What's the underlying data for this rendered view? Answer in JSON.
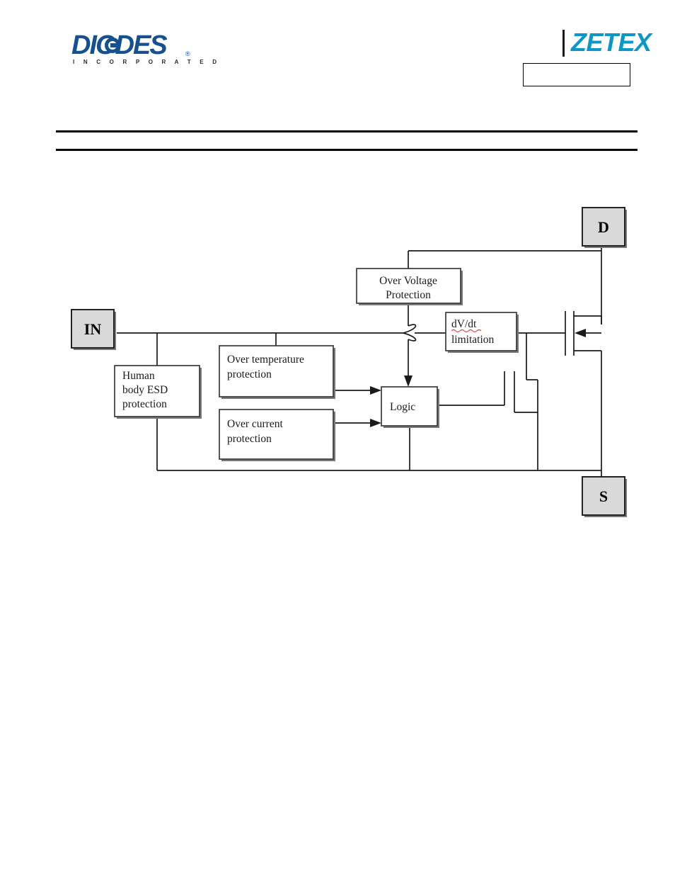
{
  "header": {
    "brand_left": {
      "name": "DIODES",
      "tagline": "I N C O R P O R A T E D",
      "registered": "®",
      "color": "#17508f"
    },
    "brand_right": {
      "name": "ZETEX",
      "color": "#0d97c6"
    },
    "part_box": {
      "value": ""
    }
  },
  "diagram": {
    "title": "",
    "terminals": [
      {
        "id": "in",
        "label": "IN"
      },
      {
        "id": "d",
        "label": "D"
      },
      {
        "id": "s",
        "label": "S"
      }
    ],
    "blocks": [
      {
        "id": "over-voltage-protection",
        "lines": [
          "Over Voltage",
          "Protection"
        ],
        "align": "center"
      },
      {
        "id": "over-temperature-protection",
        "lines": [
          "Over temperature",
          "protection"
        ],
        "align": "left"
      },
      {
        "id": "over-current-protection",
        "lines": [
          "Over current",
          "protection"
        ],
        "align": "left"
      },
      {
        "id": "human-body-esd-protection",
        "lines": [
          "Human",
          "body ESD",
          "protection"
        ],
        "align": "left"
      },
      {
        "id": "logic",
        "lines": [
          "Logic"
        ],
        "align": "left"
      },
      {
        "id": "dvdt-limitation",
        "lines": [
          "dV/dt",
          "limitation"
        ],
        "align": "left",
        "spellcheck_underline": true
      }
    ],
    "components": [
      {
        "id": "power-mosfet",
        "type": "mosfet-n-channel"
      },
      {
        "id": "wire-hop",
        "type": "wire-crossover-hop"
      }
    ],
    "colors": {
      "terminal_fill": "#d9d9d9",
      "wire": "#1a1a1a",
      "block_stroke": "#3a3a3a",
      "spellcheck": "#d94040"
    }
  }
}
